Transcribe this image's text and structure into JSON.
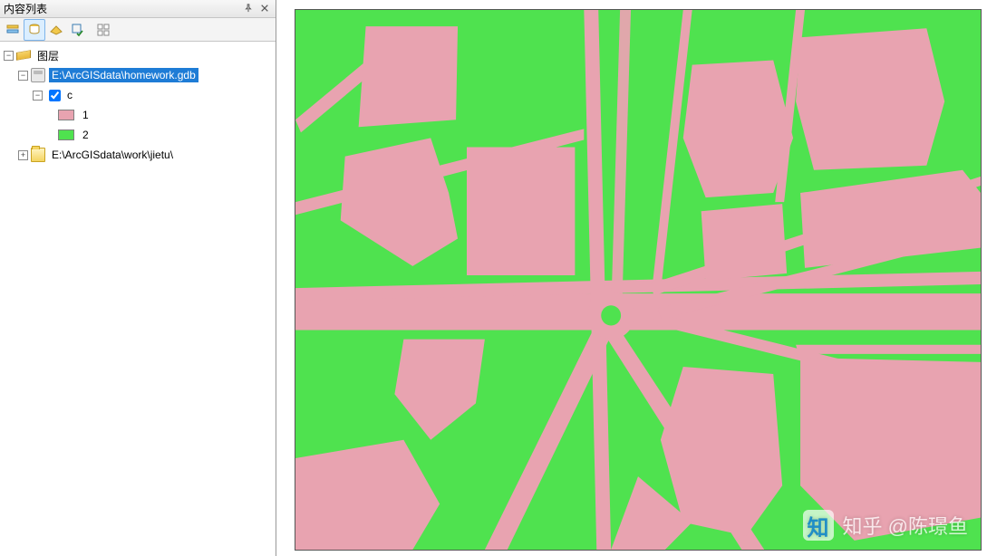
{
  "panel": {
    "title": "内容列表",
    "toolbar_buttons": [
      {
        "name": "list-by-drawing-order-button"
      },
      {
        "name": "list-by-source-button",
        "active": true
      },
      {
        "name": "list-by-visibility-button"
      },
      {
        "name": "list-by-selection-button"
      },
      {
        "name": "options-button"
      }
    ]
  },
  "tree": {
    "root_label": "图层",
    "items": [
      {
        "type": "geodatabase",
        "label": "E:\\ArcGISdata\\homework.gdb",
        "expanded": true,
        "selected": true,
        "children": [
          {
            "type": "layer",
            "label": "c",
            "expanded": true,
            "visible": true,
            "symbology": [
              {
                "value": "1",
                "fill": "#e8a3b0",
                "stroke": "#808080"
              },
              {
                "value": "2",
                "fill": "#4fe24f",
                "stroke": "#808080"
              }
            ]
          }
        ]
      },
      {
        "type": "folder",
        "label": "E:\\ArcGISdata\\work\\jietu\\",
        "expanded": false
      }
    ]
  },
  "map": {
    "background_fill": "#4fe24f",
    "feature_fill": "#e8a3b0",
    "description": "Classified polygon map: class 1 (pink) = buildings/roads, class 2 (green) = open land. Radial road intersection near center."
  },
  "watermark": {
    "logo_text": "知",
    "label": "知乎 @陈璟鱼"
  }
}
